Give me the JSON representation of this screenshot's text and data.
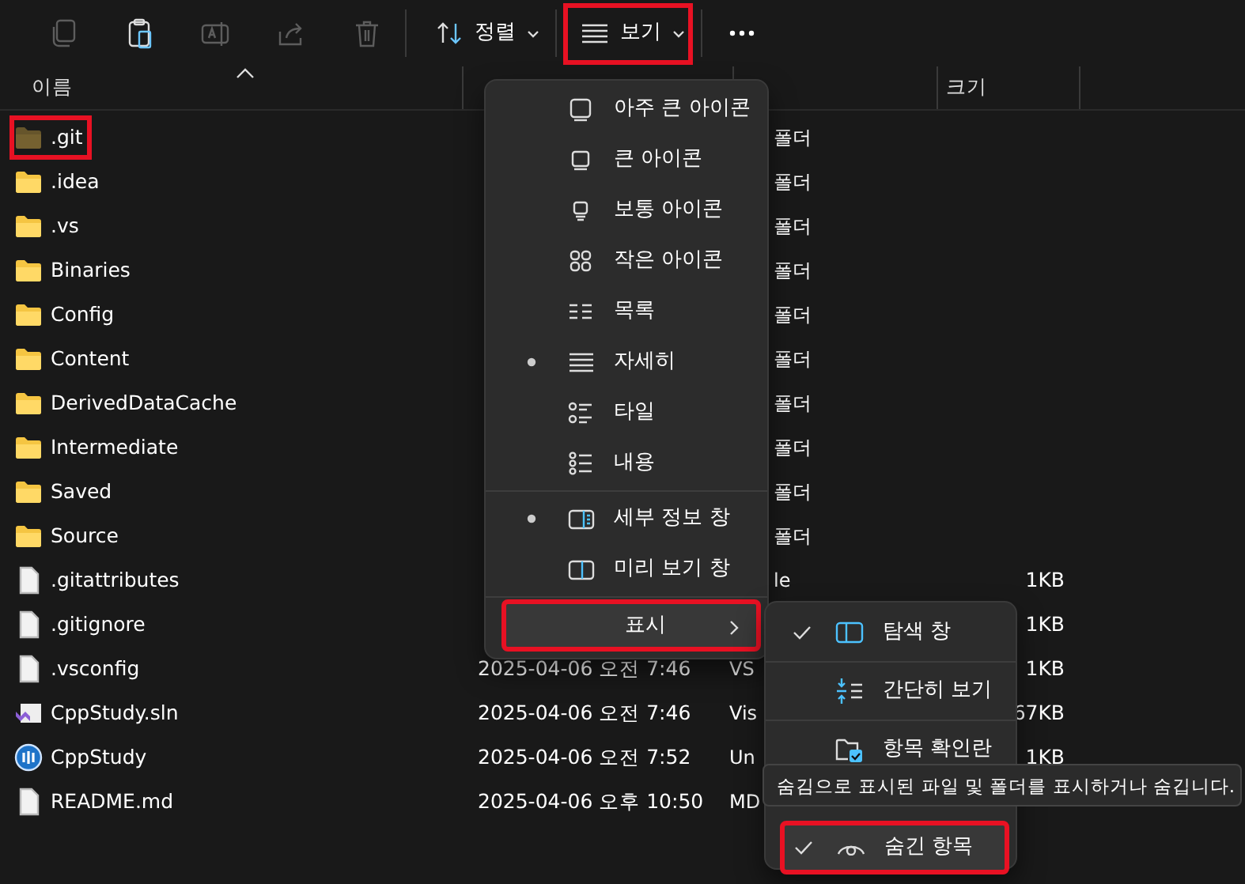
{
  "toolbar": {
    "icon_buttons": [
      {
        "kind": "copy",
        "disabled": true
      },
      {
        "kind": "paste",
        "disabled": false
      },
      {
        "kind": "rename",
        "disabled": true
      },
      {
        "kind": "share",
        "disabled": true
      },
      {
        "kind": "delete",
        "disabled": true
      }
    ],
    "sort_button": {
      "label": "정렬"
    },
    "view_button": {
      "label": "보기",
      "annotated": true
    }
  },
  "columns": [
    {
      "kind": "name",
      "label": "이름",
      "sorted": true
    },
    {
      "kind": "date",
      "sorted": false
    },
    {
      "kind": "type",
      "sorted": false
    },
    {
      "kind": "size",
      "label": "크기",
      "sorted": false
    }
  ],
  "rows": [
    {
      "name": ".git",
      "kind": "folder",
      "hidden": true,
      "annotated": true,
      "type": "폴더"
    },
    {
      "name": ".idea",
      "kind": "folder",
      "hidden": false,
      "annotated": false,
      "type": "폴더"
    },
    {
      "name": ".vs",
      "kind": "folder",
      "hidden": false,
      "annotated": false,
      "type": "폴더"
    },
    {
      "name": "Binaries",
      "kind": "folder",
      "hidden": false,
      "annotated": false,
      "type": "폴더"
    },
    {
      "name": "Config",
      "kind": "folder",
      "hidden": false,
      "annotated": false,
      "type": "폴더"
    },
    {
      "name": "Content",
      "kind": "folder",
      "hidden": false,
      "annotated": false,
      "type": "폴더"
    },
    {
      "name": "DerivedDataCache",
      "kind": "folder",
      "hidden": false,
      "annotated": false,
      "type": "폴더"
    },
    {
      "name": "Intermediate",
      "kind": "folder",
      "hidden": false,
      "annotated": false,
      "type": "폴더"
    },
    {
      "name": "Saved",
      "kind": "folder",
      "hidden": false,
      "annotated": false,
      "type": "폴더"
    },
    {
      "name": "Source",
      "kind": "folder",
      "hidden": false,
      "annotated": false,
      "type": "폴더"
    },
    {
      "name": ".gitattributes",
      "kind": "file",
      "hidden": false,
      "annotated": false,
      "type": "le",
      "size": "1KB"
    },
    {
      "name": ".gitignore",
      "kind": "file",
      "hidden": false,
      "annotated": false,
      "size": "1KB"
    },
    {
      "name": ".vsconfig",
      "kind": "file",
      "hidden": false,
      "annotated": false,
      "date": "2025-04-06 오전 7:46",
      "type": "VS",
      "size": "1KB"
    },
    {
      "name": "CppStudy.sln",
      "kind": "solution",
      "hidden": false,
      "annotated": false,
      "date": "2025-04-06 오전 7:46",
      "type": "Vis",
      "size": "67KB"
    },
    {
      "name": "CppStudy",
      "kind": "project",
      "hidden": false,
      "annotated": false,
      "date": "2025-04-06 오전 7:52",
      "type": "Un",
      "size": "1KB"
    },
    {
      "name": "README.md",
      "kind": "file",
      "hidden": false,
      "annotated": false,
      "date": "2025-04-06 오후 10:50",
      "type": "MD"
    }
  ],
  "view_menu": {
    "sections": [
      [
        {
          "kind": "extra-large",
          "label": "아주 큰 아이콘",
          "selected": false
        },
        {
          "kind": "large",
          "label": "큰 아이콘",
          "selected": false
        },
        {
          "kind": "medium",
          "label": "보통 아이콘",
          "selected": false
        },
        {
          "kind": "small",
          "label": "작은 아이콘",
          "selected": false
        },
        {
          "kind": "list",
          "label": "목록",
          "selected": false
        },
        {
          "kind": "details",
          "label": "자세히",
          "selected": true
        },
        {
          "kind": "tiles",
          "label": "타일",
          "selected": false
        },
        {
          "kind": "content",
          "label": "내용",
          "selected": false
        }
      ],
      [
        {
          "kind": "details-pane",
          "label": "세부 정보 창",
          "selected": true
        },
        {
          "kind": "preview-pane",
          "label": "미리 보기 창",
          "selected": false
        }
      ],
      [
        {
          "kind": "submenu",
          "label": "표시",
          "annotated": true,
          "expanded": true
        }
      ]
    ]
  },
  "show_submenu": {
    "items": [
      {
        "kind": "navigation-pane",
        "label": "탐색 창",
        "checked": true,
        "annotated": false
      },
      {
        "kind": "compact",
        "label": "간단히 보기",
        "checked": false,
        "annotated": false
      },
      {
        "kind": "checkboxes",
        "label": "항목 확인란",
        "checked": false,
        "annotated": false
      },
      {
        "kind": "hidden-items",
        "label": "숨긴 항목",
        "checked": true,
        "annotated": true
      }
    ]
  },
  "tooltip": {
    "text": "숨김으로 표시된 파일 및 폴더를 표시하거나 숨깁니다."
  }
}
